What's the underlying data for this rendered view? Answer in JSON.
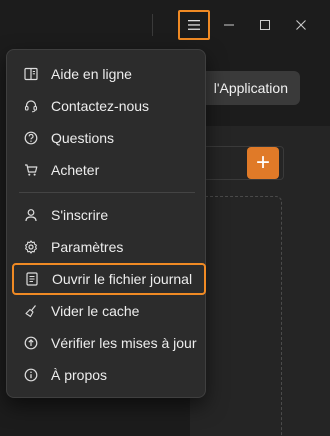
{
  "colors": {
    "accent": "#f08a24",
    "plus_button": "#e07a28",
    "menu_bg": "#2c2c2c",
    "window_bg": "#1c1c1c"
  },
  "titlebar": {
    "menu_icon": "hamburger-icon",
    "minimize_icon": "minimize-icon",
    "maximize_icon": "maximize-icon",
    "close_icon": "close-icon"
  },
  "background": {
    "app_button_label": "l'Application",
    "plus_label": "+"
  },
  "menu": {
    "items": [
      {
        "label": "Aide en ligne",
        "icon": "book-icon"
      },
      {
        "label": "Contactez-nous",
        "icon": "headset-icon"
      },
      {
        "label": "Questions",
        "icon": "question-icon"
      },
      {
        "label": "Acheter",
        "icon": "cart-icon"
      },
      {
        "label": "S'inscrire",
        "icon": "person-icon"
      },
      {
        "label": "Paramètres",
        "icon": "gear-icon"
      },
      {
        "label": "Ouvrir le fichier journal",
        "icon": "log-file-icon"
      },
      {
        "label": "Vider le cache",
        "icon": "broom-icon"
      },
      {
        "label": "Vérifier les mises à jour",
        "icon": "upload-circle-icon"
      },
      {
        "label": "À propos",
        "icon": "info-icon"
      }
    ]
  }
}
